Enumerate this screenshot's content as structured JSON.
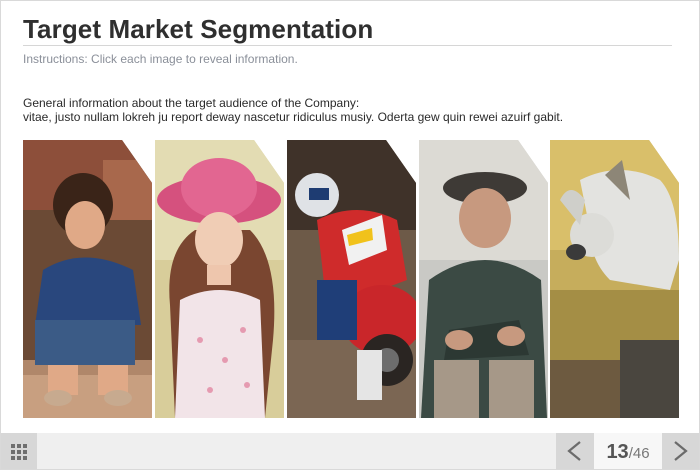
{
  "header": {
    "title": "Target Market Segmentation",
    "instructions": "Instructions: Click each image to reveal information."
  },
  "intro": {
    "line1": "General information about the target audience of the Company:",
    "line2": "vitae, justo nullam lokreh ju report deway nascetur ridiculus musiy. Oderta gew quin rewei azuirf gabit."
  },
  "cards": [
    {
      "subject": "boy",
      "plus": "+"
    },
    {
      "subject": "girl-pink-hat",
      "plus": "+"
    },
    {
      "subject": "motocross-rider",
      "plus": "+"
    },
    {
      "subject": "old-man",
      "plus": "+"
    },
    {
      "subject": "dog",
      "plus": "+"
    }
  ],
  "nav": {
    "menu_icon": "grid-icon",
    "prev_icon": "chevron-left-icon",
    "next_icon": "chevron-right-icon",
    "current_page": "13",
    "total_pages": "/46"
  },
  "colors": {
    "bar": "#efefef",
    "button": "#d7d7d7",
    "title": "#2f2f2f",
    "instructions": "#8a8f99"
  }
}
